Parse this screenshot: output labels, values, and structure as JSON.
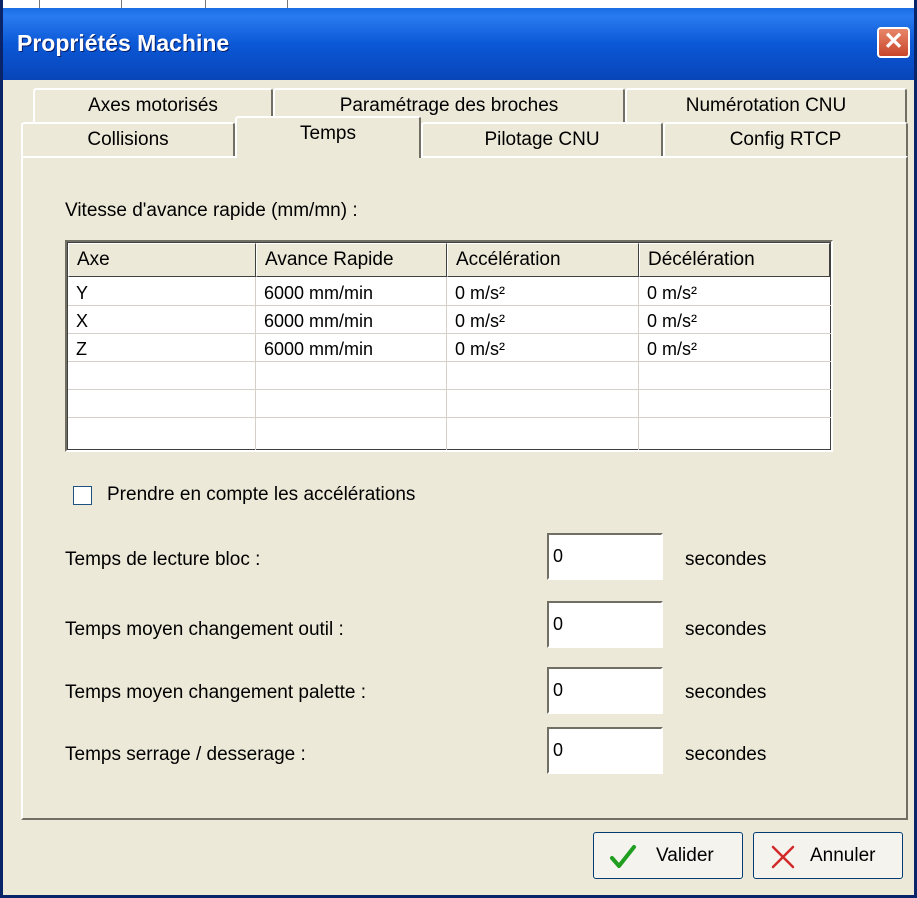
{
  "window": {
    "title": "Propriétés Machine",
    "close_symbol": "✕"
  },
  "tabs": {
    "row1": [
      "Axes motorisés",
      "Paramétrage des broches",
      "Numérotation CNU"
    ],
    "row2": [
      "Collisions",
      "Temps",
      "Pilotage CNU",
      "Config RTCP"
    ],
    "active": "Temps"
  },
  "section_label": "Vitesse d'avance rapide (mm/mn) :",
  "table": {
    "columns": [
      "Axe",
      "Avance Rapide",
      "Accélération",
      "Décélération"
    ],
    "rows": [
      [
        "Y",
        "6000 mm/min",
        "0 m/s²",
        "0 m/s²"
      ],
      [
        "X",
        "6000 mm/min",
        "0 m/s²",
        "0 m/s²"
      ],
      [
        "Z",
        "6000 mm/min",
        "0 m/s²",
        "0 m/s²"
      ]
    ]
  },
  "checkbox": {
    "label": "Prendre en compte les accélérations",
    "checked": false
  },
  "fields": [
    {
      "label": "Temps de lecture bloc :",
      "value": "0",
      "unit": "secondes"
    },
    {
      "label": "Temps moyen changement outil :",
      "value": "0",
      "unit": "secondes"
    },
    {
      "label": "Temps moyen changement palette :",
      "value": "0",
      "unit": "secondes"
    },
    {
      "label": "Temps serrage / desserage :",
      "value": "0",
      "unit": "secondes"
    }
  ],
  "buttons": {
    "ok": {
      "label": "Valider",
      "icon": "check-icon",
      "color": "#1f9e1f"
    },
    "cancel": {
      "label": "Annuler",
      "icon": "x-icon",
      "color": "#d22a2a"
    }
  }
}
